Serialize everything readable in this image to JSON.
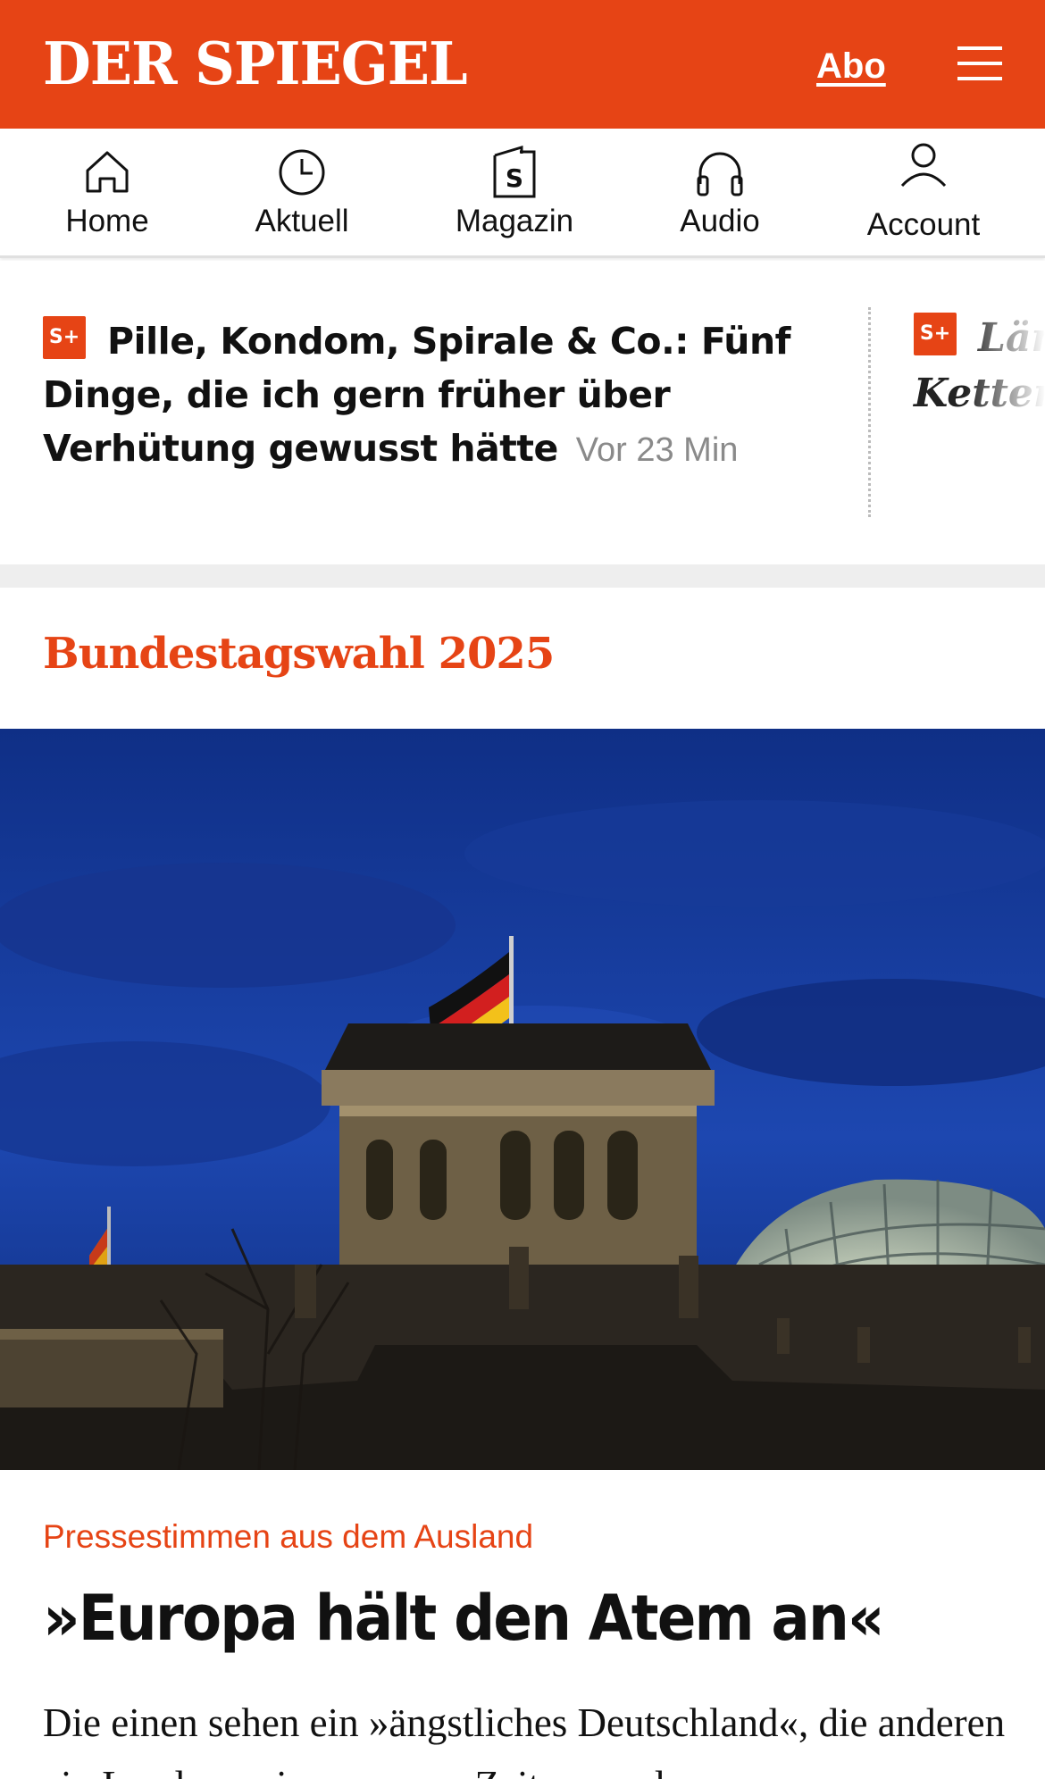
{
  "header": {
    "logo": "DER SPIEGEL",
    "abo_label": "Abo",
    "brand_color": "#e64415",
    "menu_icon": "hamburger-menu-icon"
  },
  "nav": {
    "items": [
      {
        "label": "Home",
        "icon": "home-icon"
      },
      {
        "label": "Aktuell",
        "icon": "clock-icon"
      },
      {
        "label": "Magazin",
        "icon": "magazine-icon"
      },
      {
        "label": "Audio",
        "icon": "headphones-icon"
      },
      {
        "label": "Account",
        "icon": "user-icon"
      }
    ]
  },
  "ticker": {
    "items": [
      {
        "badge": "S+",
        "title": "Pille, Kondom, Spirale & Co.: Fünf Dinge, die ich gern früher über Verhütung gewusst hätte",
        "time": "Vor 23 Min"
      },
      {
        "badge": "S+",
        "title": "Län Ketten"
      }
    ]
  },
  "section": {
    "title": "Bundestagswahl 2025"
  },
  "article": {
    "kicker": "Pressestimmen aus dem Ausland",
    "headline": "»Europa hält den Atem an«",
    "teaser": "Die einen sehen ein »ängstliches Deutschland«, die anderen ein Land vor einer »neuen Zeitenwende«"
  }
}
